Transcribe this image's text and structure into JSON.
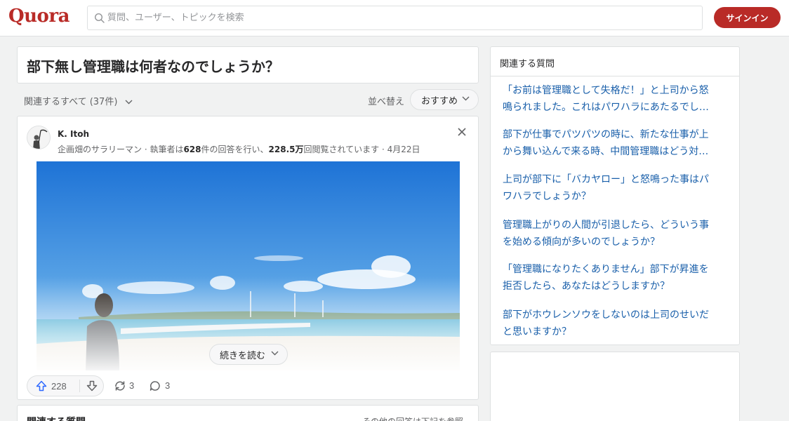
{
  "header": {
    "logo": "Quora",
    "search_placeholder": "質問、ユーザー、トピックを検索",
    "signin_label": "サインイン"
  },
  "question": {
    "title": "部下無し管理職は何者なのでしょうか？"
  },
  "filter": {
    "all_label": "関連するすべて (37件)",
    "sort_label": "並べ替え",
    "sort_value": "おすすめ"
  },
  "answer": {
    "author": "K. Itoh",
    "credential_prefix": "企画畑のサラリーマン · 執筆者は",
    "answer_count": "628",
    "credential_mid": "件の回答を行い、",
    "view_count": "228.5万",
    "credential_suffix": "回閲覧されています · 4月22日",
    "read_more": "続きを読む",
    "upvotes": "228",
    "shares": "3",
    "comments": "3"
  },
  "related_bottom": {
    "title": "関連する質問",
    "note": "その他の回答は下記を参照"
  },
  "sidebar": {
    "title": "関連する質問",
    "questions": [
      {
        "line1": "「お前は管理職として失格だ！」と上司から怒",
        "line2": "鳴られました。これはパワハラにあたるでし…"
      },
      {
        "line1": "部下が仕事でパツパツの時に、新たな仕事が上",
        "line2": "から舞い込んで来る時、中間管理職はどう対…"
      },
      {
        "line1": "上司が部下に「バカヤロー」と怒鳴った事はパ",
        "line2": "ワハラでしょうか？"
      },
      {
        "line1": "管理職上がりの人間が引退したら、どういう事",
        "line2": "を始める傾向が多いのでしょうか？"
      },
      {
        "line1": "「管理職になりたくありません」部下が昇進を",
        "line2": "拒否したら、あなたはどうしますか？"
      },
      {
        "line1": "部下がホウレンソウをしないのは上司のせいだ",
        "line2": "と思いますか？"
      }
    ]
  },
  "colors": {
    "brand": "#b92b27",
    "link": "#195faa",
    "upvote": "#2e69ff"
  }
}
